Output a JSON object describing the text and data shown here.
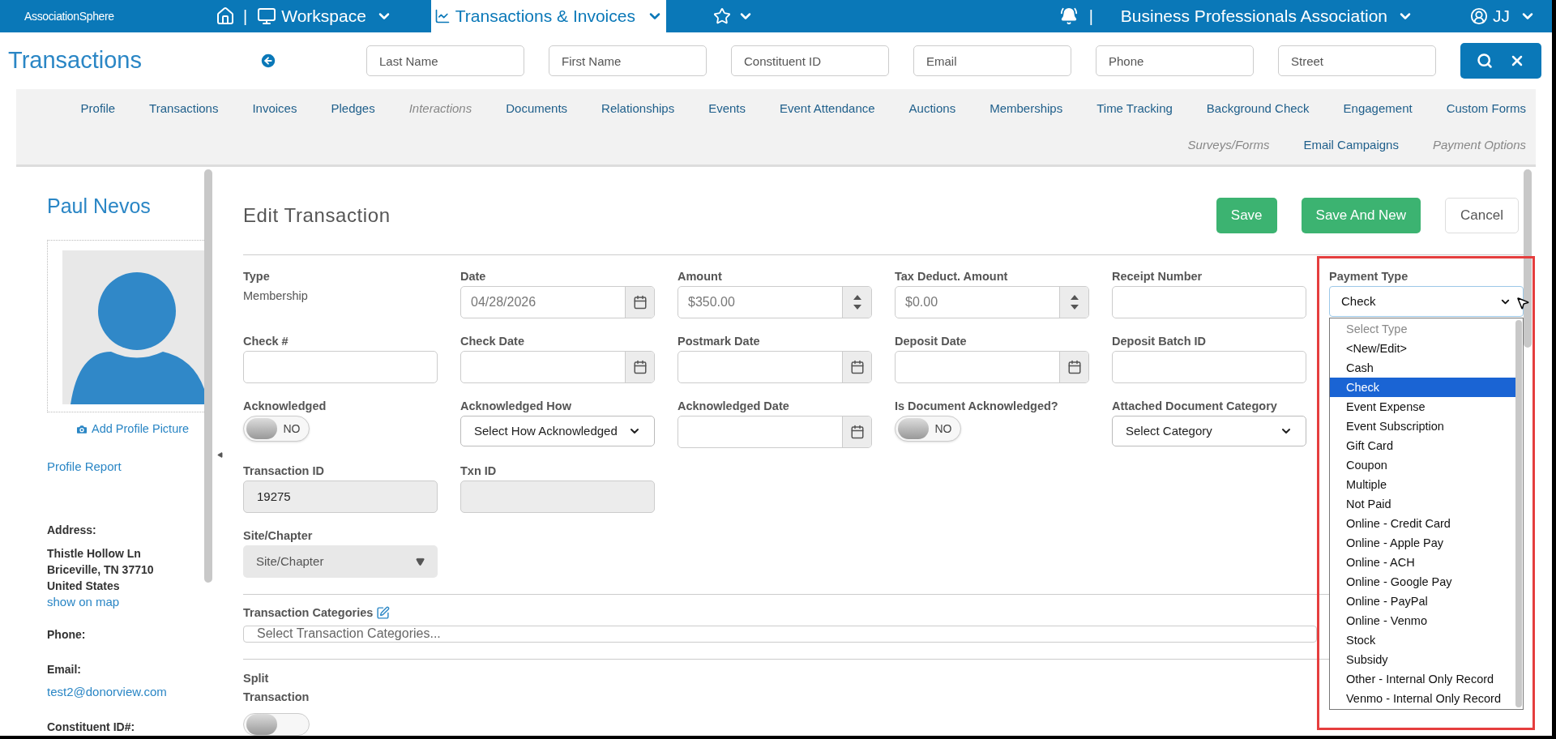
{
  "topbar": {
    "logo": "AssociationSphere",
    "home_separator": "|",
    "workspace": {
      "label": "Workspace",
      "selected": false
    },
    "transactions": {
      "label": "Transactions & Invoices",
      "selected": true
    },
    "favorites": {
      "selected": false
    },
    "org_separator": "|",
    "organization": "Business Professionals Association",
    "user": "JJ"
  },
  "page_title": "Transactions",
  "search_fields": [
    {
      "placeholder": "Last Name"
    },
    {
      "placeholder": "First Name"
    },
    {
      "placeholder": "Constituent ID"
    },
    {
      "placeholder": "Email"
    },
    {
      "placeholder": "Phone"
    },
    {
      "placeholder": "Street"
    }
  ],
  "tab_rows": [
    {
      "tabs": [
        {
          "label": "Profile",
          "disabled": false
        },
        {
          "label": "Transactions",
          "disabled": false
        },
        {
          "label": "Invoices",
          "disabled": false
        },
        {
          "label": "Pledges",
          "disabled": false
        },
        {
          "label": "Interactions",
          "disabled": true
        },
        {
          "label": "Documents",
          "disabled": false
        },
        {
          "label": "Relationships",
          "disabled": false
        },
        {
          "label": "Events",
          "disabled": false
        },
        {
          "label": "Event Attendance",
          "disabled": false
        },
        {
          "label": "Auctions",
          "disabled": false
        },
        {
          "label": "Memberships",
          "disabled": false
        },
        {
          "label": "Time Tracking",
          "disabled": false
        },
        {
          "label": "Background Check",
          "disabled": false
        },
        {
          "label": "Engagement",
          "disabled": false
        },
        {
          "label": "Custom Forms",
          "disabled": false
        }
      ]
    },
    {
      "tabs": [
        {
          "label": "Surveys/Forms",
          "disabled": true
        },
        {
          "label": "Email Campaigns",
          "disabled": false
        },
        {
          "label": "Payment Options",
          "disabled": true
        }
      ]
    }
  ],
  "profile": {
    "name": "Paul Nevos",
    "add_picture": "Add Profile Picture",
    "profile_report": "Profile Report",
    "address_label": "Address:",
    "address_lines": [
      "Thistle Hollow Ln",
      "Briceville, TN 37710",
      "United States"
    ],
    "map_link": "show on map",
    "phone_label": "Phone:",
    "email_label": "Email:",
    "email": "test2@donorview.com",
    "constituent_label": "Constituent ID#:"
  },
  "form": {
    "title": "Edit Transaction",
    "buttons": [
      {
        "label": "Save",
        "kind": "primary"
      },
      {
        "label": "Save And New",
        "kind": "primary"
      },
      {
        "label": "Cancel",
        "kind": "secondary"
      }
    ],
    "rows": [
      {
        "fields": [
          {
            "kind": "static",
            "label": "Type",
            "value": "Membership"
          },
          {
            "kind": "date",
            "label": "Date",
            "value": "04/28/2026"
          },
          {
            "kind": "number",
            "label": "Amount",
            "value": "$350.00"
          },
          {
            "kind": "number",
            "label": "Tax Deduct. Amount",
            "value": "$0.00"
          },
          {
            "kind": "text",
            "label": "Receipt Number"
          },
          {
            "kind": "dropdown",
            "label": "Payment Type",
            "value": "Check",
            "expanded": true,
            "options": [
              {
                "label": "Select Type",
                "selected": false,
                "disabled": true
              },
              {
                "label": "<New/Edit>",
                "selected": false,
                "disabled": false
              },
              {
                "label": "Cash",
                "selected": false,
                "disabled": false
              },
              {
                "label": "Check",
                "selected": true,
                "disabled": false
              },
              {
                "label": "Event Expense",
                "selected": false,
                "disabled": false
              },
              {
                "label": "Event Subscription",
                "selected": false,
                "disabled": false
              },
              {
                "label": "Gift Card",
                "selected": false,
                "disabled": false
              },
              {
                "label": "Coupon",
                "selected": false,
                "disabled": false
              },
              {
                "label": "Multiple",
                "selected": false,
                "disabled": false
              },
              {
                "label": "Not Paid",
                "selected": false,
                "disabled": false
              },
              {
                "label": "Online - Credit Card",
                "selected": false,
                "disabled": false
              },
              {
                "label": "Online - Apple Pay",
                "selected": false,
                "disabled": false
              },
              {
                "label": "Online - ACH",
                "selected": false,
                "disabled": false
              },
              {
                "label": "Online - Google Pay",
                "selected": false,
                "disabled": false
              },
              {
                "label": "Online - PayPal",
                "selected": false,
                "disabled": false
              },
              {
                "label": "Online - Venmo",
                "selected": false,
                "disabled": false
              },
              {
                "label": "Stock",
                "selected": false,
                "disabled": false
              },
              {
                "label": "Subsidy",
                "selected": false,
                "disabled": false
              },
              {
                "label": "Other - Internal Only Record",
                "selected": false,
                "disabled": false
              },
              {
                "label": "Venmo - Internal Only Record",
                "selected": false,
                "disabled": false
              }
            ]
          }
        ]
      },
      {
        "fields": [
          {
            "kind": "text",
            "label": "Check #"
          },
          {
            "kind": "date",
            "label": "Check Date"
          },
          {
            "kind": "date",
            "label": "Postmark Date"
          },
          {
            "kind": "date",
            "label": "Deposit Date"
          },
          {
            "kind": "text",
            "label": "Deposit Batch ID"
          }
        ]
      },
      {
        "fields": [
          {
            "kind": "toggle",
            "label": "Acknowledged",
            "on": false,
            "text": "NO"
          },
          {
            "kind": "select",
            "label": "Acknowledged How",
            "value": "Select How Acknowledged"
          },
          {
            "kind": "date",
            "label": "Acknowledged Date"
          },
          {
            "kind": "toggle",
            "label": "Is Document Acknowledged?",
            "on": false,
            "text": "NO"
          },
          {
            "kind": "select",
            "label": "Attached Document Category",
            "value": "Select Category"
          }
        ]
      },
      {
        "fields": [
          {
            "kind": "readonly",
            "label": "Transaction ID",
            "value": "19275"
          },
          {
            "kind": "readonly",
            "label": "Txn ID"
          }
        ]
      },
      {
        "fields": [
          {
            "kind": "readonly_select",
            "label": "Site/Chapter",
            "value": "Site/Chapter"
          }
        ]
      }
    ],
    "categories": {
      "label": "Transaction Categories",
      "placeholder": "Select Transaction Categories..."
    },
    "split": {
      "label_lines": [
        "Split",
        "Transaction"
      ],
      "on": false
    }
  }
}
